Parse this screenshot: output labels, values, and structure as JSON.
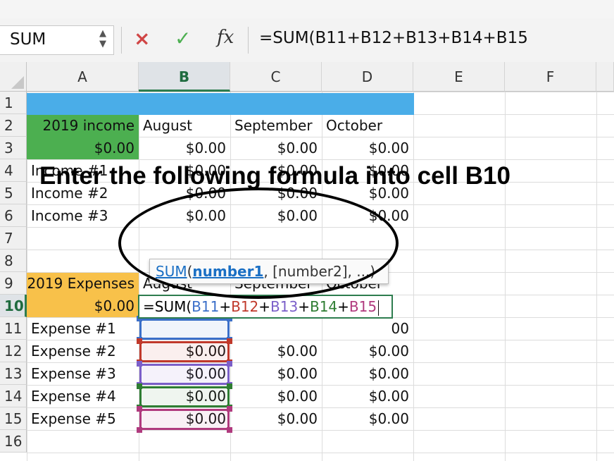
{
  "name_box": {
    "value": "SUM",
    "arrows": "▲\n▼"
  },
  "formula_bar": {
    "cancel_icon": "×",
    "enter_icon": "✓",
    "fx_label": "fx",
    "content": "=SUM(B11+B12+B13+B14+B15"
  },
  "columns": [
    "A",
    "B",
    "C",
    "D",
    "E",
    "F"
  ],
  "rows": [
    "1",
    "2",
    "3",
    "4",
    "5",
    "6",
    "7",
    "8",
    "9",
    "10",
    "11",
    "12",
    "13",
    "14",
    "15",
    "16"
  ],
  "cells": {
    "A2": "2019 income",
    "B2": "August",
    "C2": "September",
    "D2": "October",
    "A3": "$0.00",
    "B3": "$0.00",
    "C3": "$0.00",
    "D3": "$0.00",
    "A4": "Income #1",
    "B4": "$0.00",
    "C4": "$0.00",
    "D4": "$0.00",
    "A5": "Income #2",
    "B5": "$0.00",
    "C5": "$0.00",
    "D5": "$0.00",
    "A6": "Income #3",
    "B6": "$0.00",
    "C6": "$0.00",
    "D6": "$0.00",
    "A9": "2019 Expenses",
    "B9": "August",
    "C9": "September",
    "D9": "October",
    "A10": "$0.00",
    "A11": "Expense #1",
    "D11": "00",
    "A12": "Expense #2",
    "B12": "$0.00",
    "C12": "$0.00",
    "D12": "$0.00",
    "A13": "Expense #3",
    "B13": "$0.00",
    "C13": "$0.00",
    "D13": "$0.00",
    "A14": "Expense #4",
    "B14": "$0.00",
    "C14": "$0.00",
    "D14": "$0.00",
    "A15": "Expense #5",
    "B15": "$0.00",
    "C15": "$0.00",
    "D15": "$0.00"
  },
  "editing_cell": {
    "prefix": "=SUM(",
    "refs": [
      {
        "text": "B11",
        "color": "#3b6fc9"
      },
      {
        "sep": "+",
        "text": "B12",
        "color": "#c0392b"
      },
      {
        "sep": "+",
        "text": "B13",
        "color": "#7b5fc9"
      },
      {
        "sep": "+",
        "text": "B14",
        "color": "#2e7d32"
      },
      {
        "sep": "+",
        "text": "B15",
        "color": "#b03a7e"
      }
    ]
  },
  "tooltip": {
    "fn": "SUM",
    "open": "(",
    "arg1": "number1",
    "rest": ", [number2], ...)"
  },
  "callout": "Enter the following formula into cell B10",
  "colors": {
    "banner": "#4aade8",
    "income_header": "#4caf50",
    "expenses_header": "#f8c14a",
    "selected_header": "#2e7d4f"
  }
}
